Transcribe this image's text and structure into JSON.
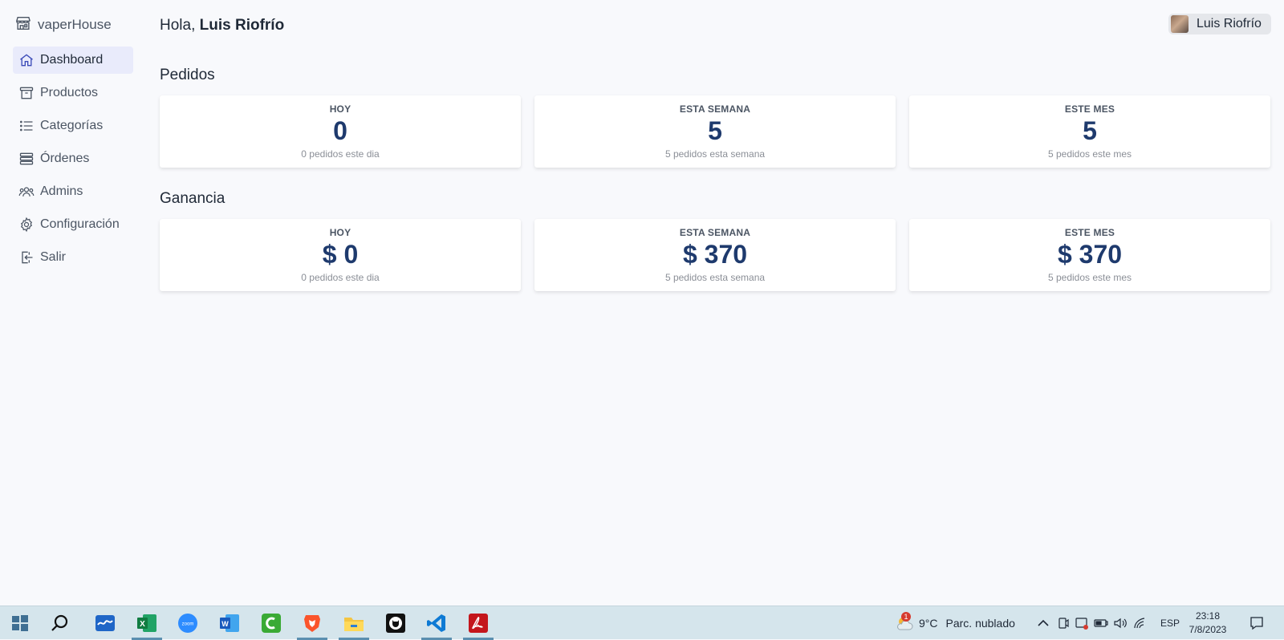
{
  "brand": {
    "name": "vaperHouse",
    "icon": "store-icon"
  },
  "sidebar": {
    "items": [
      {
        "label": "Dashboard",
        "icon": "home-icon",
        "active": true
      },
      {
        "label": "Productos",
        "icon": "archive-box-icon"
      },
      {
        "label": "Categorías",
        "icon": "list-icon"
      },
      {
        "label": "Órdenes",
        "icon": "stack-icon"
      },
      {
        "label": "Admins",
        "icon": "users-icon"
      },
      {
        "label": "Configuración",
        "icon": "gear-icon"
      },
      {
        "label": "Salir",
        "icon": "logout-icon"
      }
    ]
  },
  "header": {
    "greeting_prefix": "Hola,",
    "user_name": "Luis Riofrío",
    "chip_name": "Luis Riofrío"
  },
  "pedidos": {
    "title": "Pedidos",
    "cards": [
      {
        "label": "HOY",
        "value": "0",
        "sub": "0 pedidos este dia"
      },
      {
        "label": "ESTA SEMANA",
        "value": "5",
        "sub": "5 pedidos esta semana"
      },
      {
        "label": "ESTE MES",
        "value": "5",
        "sub": "5 pedidos este mes"
      }
    ]
  },
  "ganancia": {
    "title": "Ganancia",
    "cards": [
      {
        "label": "HOY",
        "value": "$ 0",
        "sub": "0 pedidos este dia"
      },
      {
        "label": "ESTA SEMANA",
        "value": "$ 370",
        "sub": "5 pedidos esta semana"
      },
      {
        "label": "ESTE MES",
        "value": "$ 370",
        "sub": "5 pedidos este mes"
      }
    ]
  },
  "taskbar": {
    "apps": [
      "windows-start-icon",
      "search-icon",
      "whiteboard-icon",
      "excel-icon",
      "zoom-icon",
      "word-icon",
      "camtasia-icon",
      "brave-icon",
      "file-explorer-icon",
      "github-icon",
      "vscode-icon",
      "acrobat-icon"
    ],
    "weather_temp": "9°C",
    "weather_text": "Parc. nublado",
    "weather_badge": "1",
    "language": "ESP",
    "time": "23:18",
    "date": "7/8/2023"
  },
  "colors": {
    "accent": "#1e3a6d",
    "active_bg": "#e9ebfb",
    "taskbar": "#d5e5ec"
  }
}
